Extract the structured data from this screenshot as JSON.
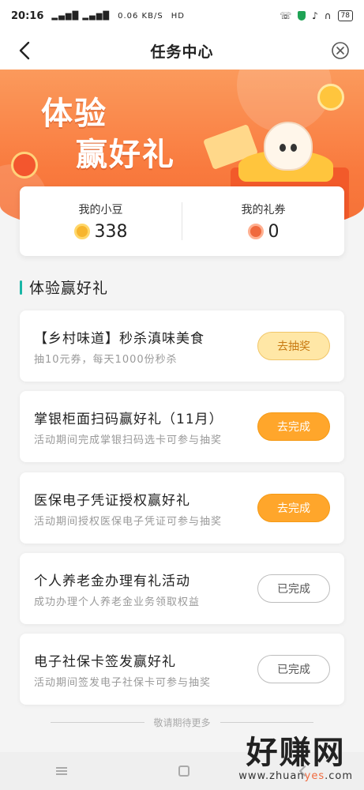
{
  "status_bar": {
    "time": "20:16",
    "signal": "▂▄▆█ ▂▄▆█",
    "speed": "0.06 KB/S",
    "hd": "HD",
    "battery": "78"
  },
  "nav": {
    "title": "任务中心"
  },
  "banner": {
    "slogan_line1": "体验",
    "slogan_line2": "赢好礼"
  },
  "stats": {
    "beans_label": "我的小豆",
    "beans_value": "338",
    "coupons_label": "我的礼券",
    "coupons_value": "0"
  },
  "section": {
    "title": "体验赢好礼"
  },
  "tasks": [
    {
      "name": "【乡村味道】秒杀滇味美食",
      "desc": "抽10元券，每天1000份秒杀",
      "button": "去抽奖"
    },
    {
      "name": "掌银柜面扫码赢好礼（11月）",
      "desc": "活动期间完成掌银扫码选卡可参与抽奖",
      "button": "去完成"
    },
    {
      "name": "医保电子凭证授权赢好礼",
      "desc": "活动期间授权医保电子凭证可参与抽奖",
      "button": "去完成"
    },
    {
      "name": "个人养老金办理有礼活动",
      "desc": "成功办理个人养老金业务领取权益",
      "button": "已完成"
    },
    {
      "name": "电子社保卡签发赢好礼",
      "desc": "活动期间签发电子社保卡可参与抽奖",
      "button": "已完成"
    }
  ],
  "footer": {
    "note": "敬请期待更多"
  },
  "watermark": {
    "big": "好赚网",
    "small_pre": "www.zhuan",
    "small_hl": "yes",
    "small_post": ".com"
  },
  "colors": {
    "banner": "#f97a3e",
    "accent_bar": "#19b6a6",
    "button_solid": "#ffa62b",
    "button_light": "#ffe7a6"
  }
}
